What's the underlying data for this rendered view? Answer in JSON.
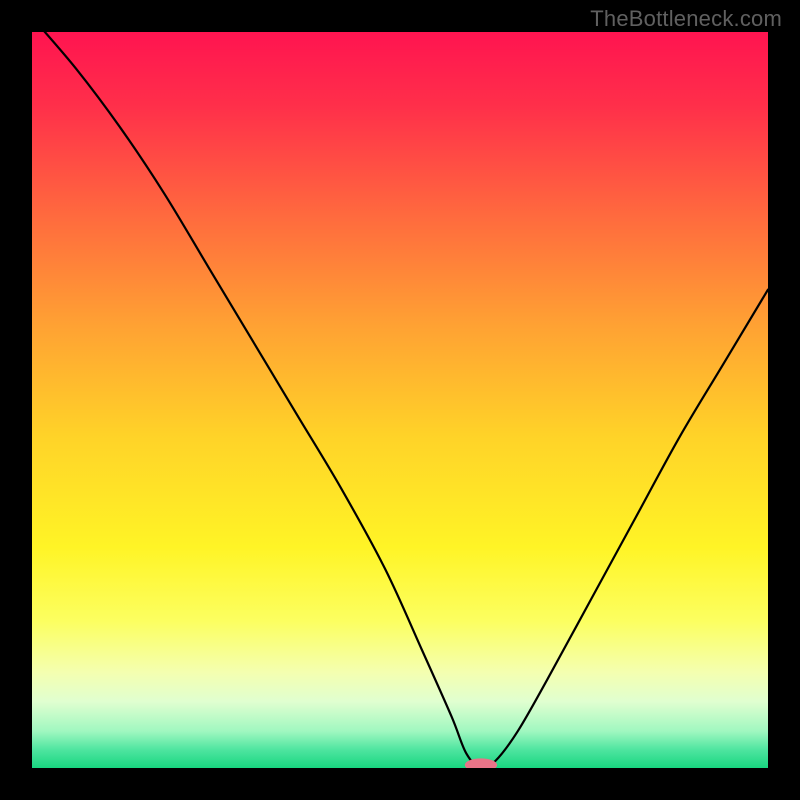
{
  "watermark": "TheBottleneck.com",
  "chart_data": {
    "type": "line",
    "title": "",
    "xlabel": "",
    "ylabel": "",
    "xlim": [
      0,
      100
    ],
    "ylim": [
      0,
      100
    ],
    "grid": false,
    "legend": false,
    "series": [
      {
        "name": "bottleneck-curve",
        "x": [
          0,
          6,
          12,
          18,
          24,
          30,
          36,
          42,
          48,
          53,
          57,
          59,
          61,
          63,
          66,
          70,
          76,
          82,
          88,
          94,
          100
        ],
        "values": [
          102,
          95,
          87,
          78,
          68,
          58,
          48,
          38,
          27,
          16,
          7,
          2,
          0,
          1,
          5,
          12,
          23,
          34,
          45,
          55,
          65
        ]
      }
    ],
    "marker": {
      "name": "optimal-point",
      "x": 61,
      "y": 0,
      "rx": 2.2,
      "ry": 0.9,
      "color": "#e97488"
    },
    "background_gradient": {
      "stops": [
        {
          "offset": 0.0,
          "color": "#ff1450"
        },
        {
          "offset": 0.1,
          "color": "#ff2f4a"
        },
        {
          "offset": 0.25,
          "color": "#ff6a3e"
        },
        {
          "offset": 0.4,
          "color": "#ffa233"
        },
        {
          "offset": 0.55,
          "color": "#ffd328"
        },
        {
          "offset": 0.7,
          "color": "#fff426"
        },
        {
          "offset": 0.8,
          "color": "#fcff60"
        },
        {
          "offset": 0.87,
          "color": "#f4ffb0"
        },
        {
          "offset": 0.91,
          "color": "#e0ffd0"
        },
        {
          "offset": 0.95,
          "color": "#a0f7c0"
        },
        {
          "offset": 0.975,
          "color": "#4fe5a0"
        },
        {
          "offset": 1.0,
          "color": "#18d680"
        }
      ]
    },
    "line_style": {
      "stroke": "#000000",
      "width": 2.2
    }
  }
}
